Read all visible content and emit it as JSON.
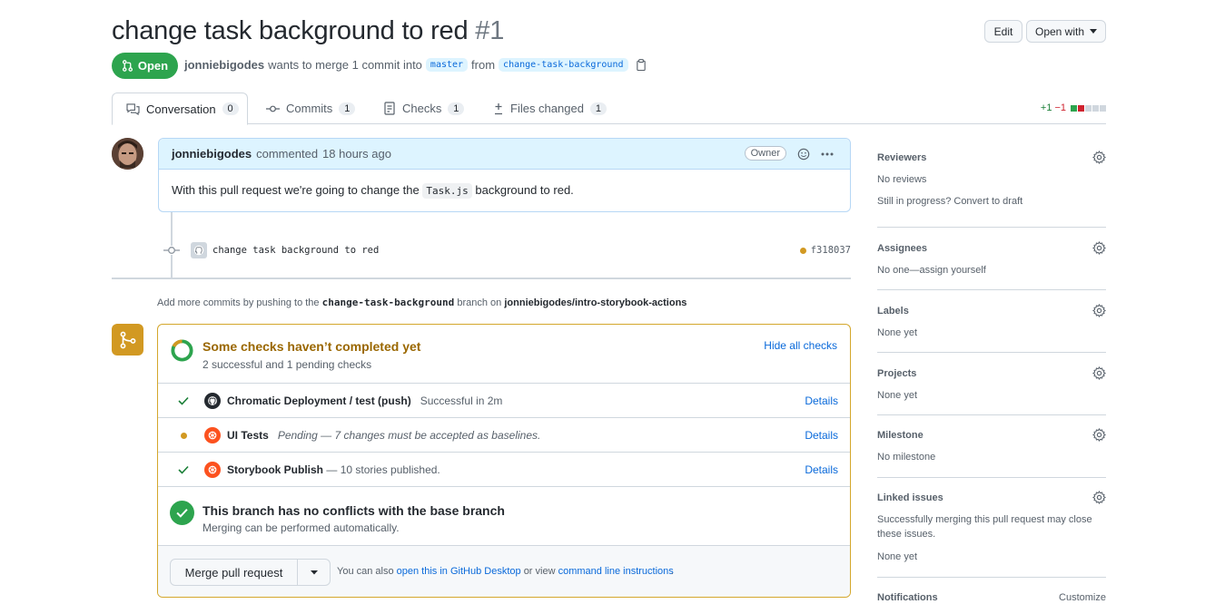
{
  "header": {
    "title": "change task background to red",
    "number": "#1",
    "edit_label": "Edit",
    "open_with_label": "Open with",
    "state": "Open",
    "author": "jonniebigodes",
    "meta_text": "wants to merge 1 commit into",
    "base_branch": "master",
    "from_text": "from",
    "head_branch": "change-task-background"
  },
  "tabs": [
    {
      "label": "Conversation",
      "count": "0"
    },
    {
      "label": "Commits",
      "count": "1"
    },
    {
      "label": "Checks",
      "count": "1"
    },
    {
      "label": "Files changed",
      "count": "1"
    }
  ],
  "diffstat": {
    "added": "+1",
    "removed": "−1"
  },
  "comment": {
    "author": "jonniebigodes",
    "action": "commented",
    "time": "18 hours ago",
    "role": "Owner",
    "body_pre": "With this pull request we're going to change the",
    "body_code": "Task.js",
    "body_post": "background to red."
  },
  "commit": {
    "message": "change task background to red",
    "sha": "f318037"
  },
  "push_hint": {
    "pre": "Add more commits by pushing to the",
    "branch": "change-task-background",
    "mid": "branch on",
    "repo": "jonniebigodes/intro-storybook-actions",
    "post": "."
  },
  "checks": {
    "title": "Some checks haven’t completed yet",
    "subtitle": "2 successful and 1 pending checks",
    "toggle": "Hide all checks",
    "items": [
      {
        "name": "Chromatic Deployment / test (push)",
        "desc": "Successful in 2m",
        "details": "Details"
      },
      {
        "name": "UI Tests",
        "desc": "Pending — 7 changes must be accepted as baselines.",
        "details": "Details"
      },
      {
        "name": "Storybook Publish",
        "desc": "— 10 stories published.",
        "details": "Details"
      }
    ]
  },
  "conflicts": {
    "title": "This branch has no conflicts with the base branch",
    "subtitle": "Merging can be performed automatically."
  },
  "merge": {
    "button": "Merge pull request",
    "alt_pre": "You can also",
    "alt_link1": "open this in GitHub Desktop",
    "alt_mid": "or view",
    "alt_link2": "command line instructions",
    "alt_post": "."
  },
  "sidebar": {
    "reviewers": {
      "title": "Reviewers",
      "value": "No reviews",
      "extra": "Still in progress? Convert to draft"
    },
    "assignees": {
      "title": "Assignees",
      "value": "No one—assign yourself"
    },
    "labels": {
      "title": "Labels",
      "value": "None yet"
    },
    "projects": {
      "title": "Projects",
      "value": "None yet"
    },
    "milestone": {
      "title": "Milestone",
      "value": "No milestone"
    },
    "linked": {
      "title": "Linked issues",
      "desc": "Successfully merging this pull request may close these issues.",
      "value": "None yet"
    },
    "notifications": {
      "title": "Notifications",
      "action": "Customize"
    }
  }
}
